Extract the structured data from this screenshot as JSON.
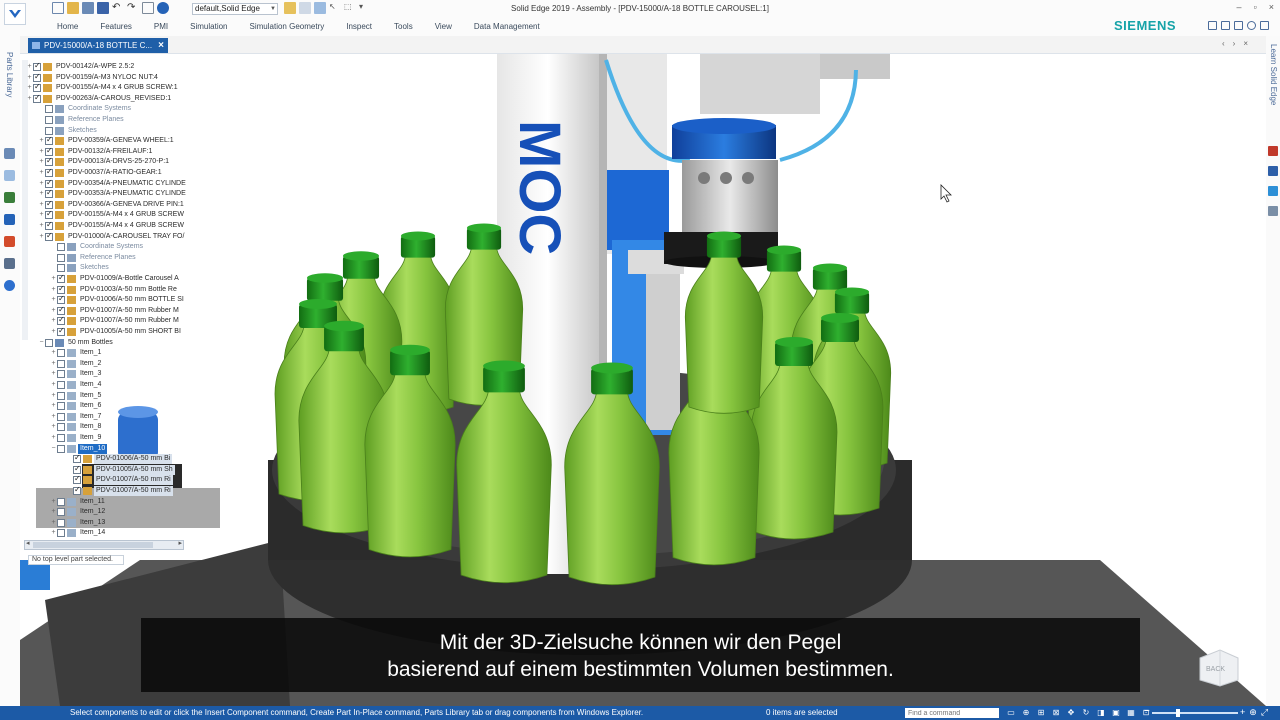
{
  "window": {
    "title": "Solid Edge 2019 - Assembly - [PDV-15000/A-18 BOTTLE CAROUSEL:1]",
    "controls": [
      "–",
      "▫",
      "×"
    ]
  },
  "quick_access": {
    "config_value": "default,Solid Edge"
  },
  "ribbon": {
    "tabs": [
      "Home",
      "Features",
      "PMI",
      "Simulation",
      "Simulation Geometry",
      "Inspect",
      "Tools",
      "View",
      "Data Management"
    ],
    "brand": "SIEMENS"
  },
  "document_tab": {
    "label": "PDV-15000/A-18 BOTTLE C...",
    "close": "×"
  },
  "left_strip": {
    "label": "Parts Library"
  },
  "right_strip": {
    "label": "Learn Solid Edge"
  },
  "tree": {
    "rows": [
      {
        "label": "PDV-00142/A-WPE 2.5:2",
        "exp": "+",
        "cb": true,
        "icon": "part",
        "indent": 0,
        "style": ""
      },
      {
        "label": "PDV-00159/A-M3 NYLOC NUT:4",
        "exp": "+",
        "cb": true,
        "icon": "part",
        "indent": 0,
        "style": ""
      },
      {
        "label": "PDV-00155/A-M4 x 4 GRUB SCREW:1",
        "exp": "+",
        "cb": true,
        "icon": "part",
        "indent": 0,
        "style": ""
      },
      {
        "label": "PDV-00263/A-CAROUS_REVISED:1",
        "exp": "+",
        "cb": true,
        "icon": "asm",
        "indent": 0,
        "style": ""
      },
      {
        "label": "Coordinate Systems",
        "exp": "",
        "cb": false,
        "icon": "coord",
        "indent": 1,
        "style": "grey"
      },
      {
        "label": "Reference Planes",
        "exp": "",
        "cb": false,
        "icon": "plane",
        "indent": 1,
        "style": "grey"
      },
      {
        "label": "Sketches",
        "exp": "",
        "cb": false,
        "icon": "sketch",
        "indent": 1,
        "style": "grey"
      },
      {
        "label": "PDV-00359/A-GENEVA WHEEL:1",
        "exp": "+",
        "cb": true,
        "icon": "part",
        "indent": 1,
        "style": ""
      },
      {
        "label": "PDV-00132/A-FREILAUF:1",
        "exp": "+",
        "cb": true,
        "icon": "part",
        "indent": 1,
        "style": ""
      },
      {
        "label": "PDV-00013/A-DRVS-25-270-P:1",
        "exp": "+",
        "cb": true,
        "icon": "part",
        "indent": 1,
        "style": ""
      },
      {
        "label": "PDV-00037/A-RATIO-GEAR:1",
        "exp": "+",
        "cb": true,
        "icon": "part",
        "indent": 1,
        "style": ""
      },
      {
        "label": "PDV-00354/A-PNEUMATIC CYLINDE",
        "exp": "+",
        "cb": true,
        "icon": "part",
        "indent": 1,
        "style": ""
      },
      {
        "label": "PDV-00353/A-PNEUMATIC CYLINDE",
        "exp": "+",
        "cb": true,
        "icon": "part",
        "indent": 1,
        "style": ""
      },
      {
        "label": "PDV-00366/A-GENEVA DRIVE PIN:1",
        "exp": "+",
        "cb": true,
        "icon": "part",
        "indent": 1,
        "style": ""
      },
      {
        "label": "PDV-00155/A-M4 x 4 GRUB SCREW",
        "exp": "+",
        "cb": true,
        "icon": "part",
        "indent": 1,
        "style": ""
      },
      {
        "label": "PDV-00155/A-M4 x 4 GRUB SCREW",
        "exp": "+",
        "cb": true,
        "icon": "part",
        "indent": 1,
        "style": ""
      },
      {
        "label": "PDV-01000/A-CAROUSEL TRAY FO/",
        "exp": "+",
        "cb": true,
        "icon": "asm",
        "indent": 1,
        "style": ""
      },
      {
        "label": "Coordinate Systems",
        "exp": "",
        "cb": false,
        "icon": "coord",
        "indent": 2,
        "style": "grey"
      },
      {
        "label": "Reference Planes",
        "exp": "",
        "cb": false,
        "icon": "plane",
        "indent": 2,
        "style": "grey"
      },
      {
        "label": "Sketches",
        "exp": "",
        "cb": false,
        "icon": "sketch",
        "indent": 2,
        "style": "grey"
      },
      {
        "label": "PDV-01009/A-Bottle Carousel A",
        "exp": "+",
        "cb": true,
        "icon": "part",
        "indent": 2,
        "style": ""
      },
      {
        "label": "PDV-01003/A-50 mm Bottle Re",
        "exp": "+",
        "cb": true,
        "icon": "part",
        "indent": 2,
        "style": ""
      },
      {
        "label": "PDV-01006/A-50 mm BOTTLE SI",
        "exp": "+",
        "cb": true,
        "icon": "part",
        "indent": 2,
        "style": ""
      },
      {
        "label": "PDV-01007/A-50 mm Rubber M",
        "exp": "+",
        "cb": true,
        "icon": "part",
        "indent": 2,
        "style": ""
      },
      {
        "label": "PDV-01007/A-50 mm Rubber M",
        "exp": "+",
        "cb": true,
        "icon": "part",
        "indent": 2,
        "style": ""
      },
      {
        "label": "PDV-01005/A-50 mm SHORT BI",
        "exp": "+",
        "cb": true,
        "icon": "part",
        "indent": 2,
        "style": ""
      },
      {
        "label": "50 mm Bottles",
        "exp": "−",
        "cb": false,
        "icon": "pattern",
        "indent": 1,
        "style": ""
      },
      {
        "label": "Item_1",
        "exp": "+",
        "cb": false,
        "icon": "item",
        "indent": 2,
        "style": ""
      },
      {
        "label": "Item_2",
        "exp": "+",
        "cb": false,
        "icon": "item",
        "indent": 2,
        "style": ""
      },
      {
        "label": "Item_3",
        "exp": "+",
        "cb": false,
        "icon": "item",
        "indent": 2,
        "style": ""
      },
      {
        "label": "Item_4",
        "exp": "+",
        "cb": false,
        "icon": "item",
        "indent": 2,
        "style": ""
      },
      {
        "label": "Item_5",
        "exp": "+",
        "cb": false,
        "icon": "item",
        "indent": 2,
        "style": ""
      },
      {
        "label": "Item_6",
        "exp": "+",
        "cb": false,
        "icon": "item",
        "indent": 2,
        "style": ""
      },
      {
        "label": "Item_7",
        "exp": "+",
        "cb": false,
        "icon": "item",
        "indent": 2,
        "style": ""
      },
      {
        "label": "Item_8",
        "exp": "+",
        "cb": false,
        "icon": "item",
        "indent": 2,
        "style": ""
      },
      {
        "label": "Item_9",
        "exp": "+",
        "cb": false,
        "icon": "item",
        "indent": 2,
        "style": ""
      },
      {
        "label": "Item_10",
        "exp": "−",
        "cb": false,
        "icon": "item",
        "indent": 2,
        "style": "sel"
      },
      {
        "label": "PDV-01006/A-50 mm Bi",
        "exp": "",
        "cb": true,
        "icon": "part",
        "indent": 3,
        "style": "dark"
      },
      {
        "label": "PDV-01005/A-50 mm Sh",
        "exp": "",
        "cb": true,
        "icon": "part",
        "indent": 3,
        "style": "dark"
      },
      {
        "label": "PDV-01007/A-50 mm Ri",
        "exp": "",
        "cb": true,
        "icon": "part",
        "indent": 3,
        "style": "dark"
      },
      {
        "label": "PDV-01007/A-50 mm Ri",
        "exp": "",
        "cb": true,
        "icon": "part",
        "indent": 3,
        "style": "dark"
      },
      {
        "label": "Item_11",
        "exp": "+",
        "cb": false,
        "icon": "item",
        "indent": 2,
        "style": ""
      },
      {
        "label": "Item_12",
        "exp": "+",
        "cb": false,
        "icon": "item",
        "indent": 2,
        "style": ""
      },
      {
        "label": "Item_13",
        "exp": "+",
        "cb": false,
        "icon": "item",
        "indent": 2,
        "style": ""
      },
      {
        "label": "Item_14",
        "exp": "+",
        "cb": false,
        "icon": "item",
        "indent": 2,
        "style": ""
      }
    ],
    "status": "No top level part selected."
  },
  "viewport": {
    "column_text": "MOC",
    "view_cube_label": "BACK"
  },
  "subtitle": {
    "line1": "Mit der 3D-Zielsuche können wir den Pegel",
    "line2": "basierend auf einem bestimmten Volumen bestimmen."
  },
  "statusbar": {
    "message": "Select components to edit or click the Insert Component command, Create Part In-Place command, Parts Library tab or drag components from Windows Explorer.",
    "selection_count": "0 items are selected",
    "find_placeholder": "Find a command",
    "tools": [
      "▭",
      "⊕",
      "⊞",
      "⊠",
      "✥",
      "↻",
      "◨",
      "▣",
      "▦",
      "⊡"
    ],
    "zoom_minus": "−",
    "zoom_plus": "+"
  },
  "colors": {
    "accent_blue": "#1c5aa6",
    "brand_teal": "#16a3a8",
    "bottle_green": "#7fc23c",
    "cap_green": "#1f8a1f",
    "selection_blue": "#1f6cc5"
  }
}
